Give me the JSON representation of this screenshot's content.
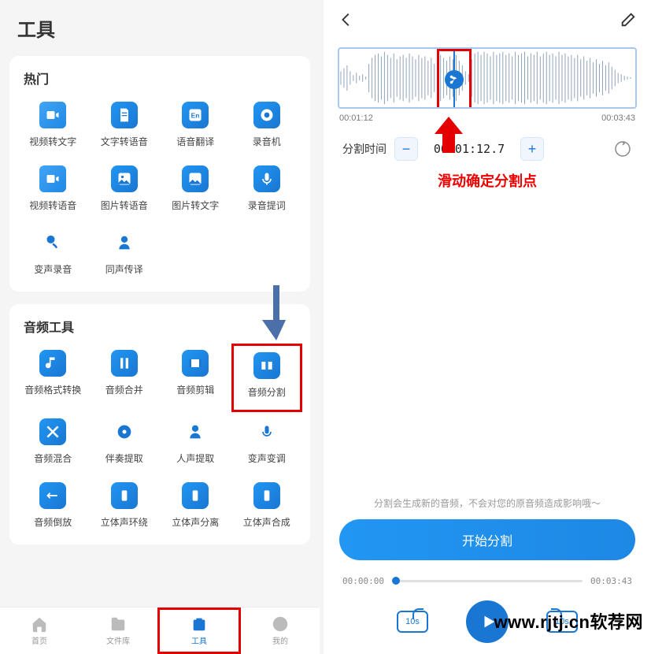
{
  "left": {
    "pageTitle": "工具",
    "sections": {
      "hot": {
        "title": "热门",
        "items": [
          {
            "label": "视频转文字",
            "icon": "text"
          },
          {
            "label": "文字转语音",
            "icon": "doc"
          },
          {
            "label": "语音翻译",
            "icon": "en"
          },
          {
            "label": "录音机",
            "icon": "rec"
          },
          {
            "label": "视频转语音",
            "icon": "vid"
          },
          {
            "label": "图片转语音",
            "icon": "img"
          },
          {
            "label": "图片转文字",
            "icon": "img2"
          },
          {
            "label": "录音提词",
            "icon": "mic"
          },
          {
            "label": "变声录音",
            "icon": "voice"
          },
          {
            "label": "同声传译",
            "icon": "person"
          }
        ]
      },
      "audio": {
        "title": "音频工具",
        "items": [
          {
            "label": "音频格式转换",
            "icon": "note"
          },
          {
            "label": "音频合并",
            "icon": "merge"
          },
          {
            "label": "音频剪辑",
            "icon": "clip"
          },
          {
            "label": "音频分割",
            "icon": "split",
            "highlight": true
          },
          {
            "label": "音频混合",
            "icon": "mix"
          },
          {
            "label": "伴奏提取",
            "icon": "disc"
          },
          {
            "label": "人声提取",
            "icon": "vocals"
          },
          {
            "label": "变声变调",
            "icon": "pitch"
          },
          {
            "label": "音频倒放",
            "icon": "reverse"
          },
          {
            "label": "立体声环绕",
            "icon": "surround"
          },
          {
            "label": "立体声分离",
            "icon": "stereo-split"
          },
          {
            "label": "立体声合成",
            "icon": "stereo-merge"
          }
        ]
      }
    },
    "nav": [
      {
        "label": "首页",
        "icon": "home"
      },
      {
        "label": "文件库",
        "icon": "folder"
      },
      {
        "label": "工具",
        "icon": "tools",
        "active": true,
        "highlight": true
      },
      {
        "label": "我的",
        "icon": "me"
      }
    ]
  },
  "right": {
    "waveform": {
      "start": "00:01:12",
      "end": "00:03:43"
    },
    "splitTime": {
      "label": "分割时间",
      "value": "00:01:12.7"
    },
    "hint": "滑动确定分割点",
    "note": "分割会生成新的音频，不会对您的原音频造成影响哦～",
    "startButton": "开始分割",
    "timeline": {
      "current": "00:00:00",
      "total": "00:03:43"
    },
    "skip": {
      "back": "10s",
      "fwd": "10s"
    }
  },
  "watermark": "www.rjtj.cn软荐网"
}
